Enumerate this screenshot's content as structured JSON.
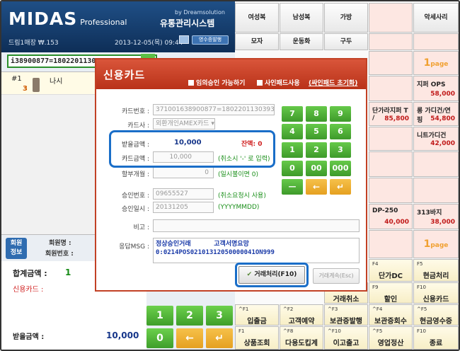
{
  "brand": {
    "logo": "MIDAS",
    "logo_sub": "Professional",
    "by": "by Dreamsolution",
    "system_name": "유통관리시스템",
    "store": "드림1매장 ₩.153",
    "datetime": "2013-12-05(목) 09:44",
    "receipt_button": "영수증발행"
  },
  "barcode_input": "i38900877=18022011303",
  "items": [
    {
      "no": "#1",
      "qty": "3",
      "name": "나시"
    }
  ],
  "member": {
    "tag_line1": "회원",
    "tag_line2": "정보",
    "name_label": "회원명 :",
    "no_label": "회원번호 :"
  },
  "totals": {
    "sum_label": "합계금액 :",
    "sum_value": "1",
    "card_label": "신용카드 :",
    "received_label": "받을금액 :",
    "received_value": "10,000"
  },
  "bg_keypad": [
    "1",
    "2",
    "3",
    "0",
    "←",
    "↵"
  ],
  "grid": {
    "top_row": [
      {
        "label": "여성복",
        "style": "top"
      },
      {
        "label": "남성복",
        "style": "top"
      },
      {
        "label": "가방",
        "style": "top"
      },
      {
        "label": "",
        "style": "pink"
      },
      {
        "label": "악세사리",
        "style": "top"
      }
    ],
    "second_row": [
      {
        "label": "모자"
      },
      {
        "label": "운동화"
      },
      {
        "label": "구두"
      }
    ],
    "page1": {
      "num": "1",
      "unit": "page"
    },
    "page2": {
      "num": "1",
      "unit": "page"
    },
    "products": [
      {
        "name": "지퍼 OPS",
        "price": "58,000"
      },
      {
        "name": "단가라지퍼 T /",
        "price": "85,800"
      },
      {
        "name": "롱 가디건/연 핑",
        "price": "54,800"
      },
      {
        "name": "니트가디건",
        "price": "42,000"
      },
      {
        "name": "DP-250",
        "price": "40,000"
      },
      {
        "name": "313바지",
        "price": "38,000"
      }
    ],
    "fn_row1": [
      {
        "key": "F4",
        "label": "단가DC"
      },
      {
        "key": "F5",
        "label": "현금처리"
      }
    ],
    "fn_row2": [
      {
        "key": "",
        "label": "거래취소"
      },
      {
        "key": "F9",
        "label": "할인"
      },
      {
        "key": "F10",
        "label": "신용카드"
      }
    ],
    "fn_row3": [
      {
        "key": "^F1",
        "label": "입출금"
      },
      {
        "key": "^F2",
        "label": "고객예약"
      },
      {
        "key": "^F3",
        "label": "보관증발행"
      },
      {
        "key": "^F4",
        "label": "보관증회수"
      },
      {
        "key": "^F5",
        "label": "현금영수증"
      }
    ],
    "fn_row4": [
      {
        "key": "F1",
        "label": "상품조회"
      },
      {
        "key": "^F8",
        "label": "다용도킵계"
      },
      {
        "key": "^F10",
        "label": "이고출고"
      },
      {
        "key": "^F5",
        "label": "영업정산"
      },
      {
        "key": "F10",
        "label": "종료"
      }
    ]
  },
  "dialog": {
    "title": "신용카드",
    "opt_temp": "임의승인 가능하기",
    "opt_sign": "사인패드사용",
    "opt_reset": "(싸인패드 초기화)",
    "card_no_label": "카드번호 :",
    "card_no_value": "371001638900877=18022011303936588800",
    "card_co_label": "카드사 :",
    "card_co_value": "외환개인AMEX카드",
    "recv_label": "받을금액 :",
    "recv_value": "10,000",
    "balance": "잔액: 0",
    "card_amt_label": "카드금액 :",
    "card_amt_value": "10,000",
    "card_amt_note": "(취소시 '-' 로 입력)",
    "install_label": "할부개월 :",
    "install_value": "0",
    "install_note": "(일시불이면 0)",
    "approve_no_label": "승인번호 :",
    "approve_no_value": "09655527",
    "approve_no_note": "(취소요청시 사용)",
    "approve_date_label": "승인일시 :",
    "approve_date_value": "20131205",
    "approve_date_note": "(YYYYMMDD)",
    "memo_label": "비고 :",
    "resp_label": "응답MSG :",
    "resp_msg": "정상승인거래      고객서명요망\n0:0214POS02101312050000041ON999",
    "ok_button": "거래처리(F10)",
    "cancel_button": "거래계속(Esc)",
    "keypad": [
      "7",
      "8",
      "9",
      "4",
      "5",
      "6",
      "1",
      "2",
      "3",
      "0",
      "00",
      "000",
      "—",
      "←",
      "↵"
    ]
  }
}
